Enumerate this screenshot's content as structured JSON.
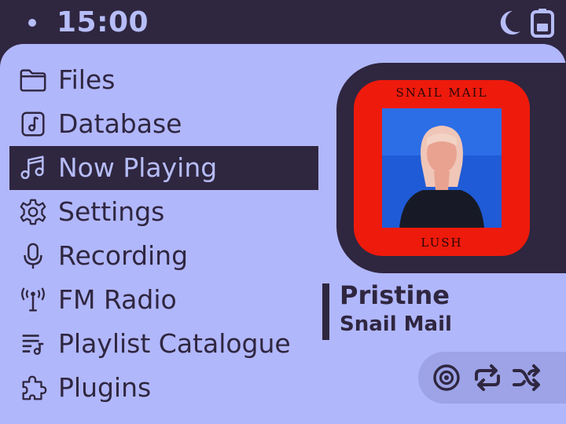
{
  "status": {
    "time": "15:00",
    "icons": [
      "dot-icon",
      "moon-icon",
      "battery-icon"
    ]
  },
  "menu": {
    "items": [
      {
        "label": "Files",
        "icon": "folder-icon"
      },
      {
        "label": "Database",
        "icon": "music-file-icon"
      },
      {
        "label": "Now Playing",
        "icon": "music-note-icon",
        "selected": true
      },
      {
        "label": "Settings",
        "icon": "gear-icon"
      },
      {
        "label": "Recording",
        "icon": "microphone-icon"
      },
      {
        "label": "FM Radio",
        "icon": "antenna-icon"
      },
      {
        "label": "Playlist Catalogue",
        "icon": "playlist-icon"
      },
      {
        "label": "Plugins",
        "icon": "puzzle-icon"
      }
    ]
  },
  "now_playing": {
    "album_top_text": "SNAIL MAIL",
    "album_bottom_text": "LUSH",
    "title": "Pristine",
    "artist": "Snail Mail"
  },
  "controls": [
    "target-icon",
    "repeat-icon",
    "shuffle-icon"
  ],
  "colors": {
    "background": "#2f2640",
    "panel": "#b1b7fb",
    "accent_text": "#b6bdf7",
    "album_red": "#ee1a0c",
    "controls_bg": "#9da3e6"
  }
}
